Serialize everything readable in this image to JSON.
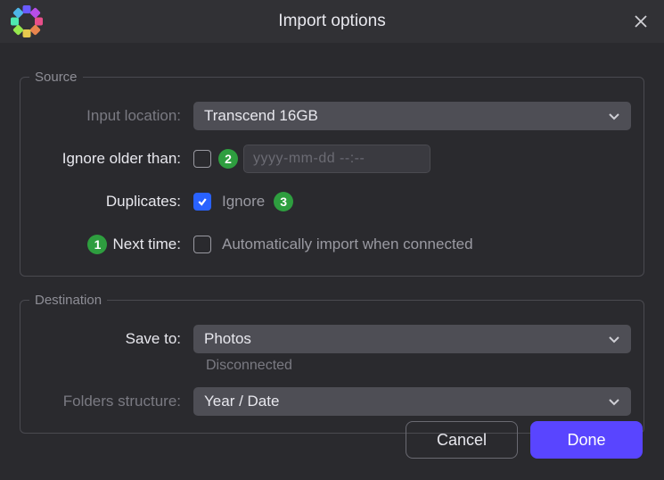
{
  "window": {
    "title": "Import options"
  },
  "badges": {
    "one": "1",
    "two": "2",
    "three": "3"
  },
  "source": {
    "legend": "Source",
    "input_location_label": "Input location:",
    "input_location_value": "Transcend 16GB",
    "ignore_older_label": "Ignore older than:",
    "ignore_older_checked": false,
    "ignore_older_placeholder": "yyyy-mm-dd --:--",
    "duplicates_label": "Duplicates:",
    "duplicates_checked": true,
    "duplicates_text": "Ignore",
    "next_time_label": "Next time:",
    "next_time_checked": false,
    "next_time_text": "Automatically import when connected"
  },
  "destination": {
    "legend": "Destination",
    "save_to_label": "Save to:",
    "save_to_value": "Photos",
    "save_to_status": "Disconnected",
    "folders_label": "Folders structure:",
    "folders_value": "Year / Date"
  },
  "footer": {
    "cancel": "Cancel",
    "done": "Done"
  },
  "logo_colors": [
    "#e84e8a",
    "#e8854e",
    "#e8c94e",
    "#96e84e",
    "#4ee8b0",
    "#4eb6e8",
    "#6a5bff",
    "#b84ee8"
  ]
}
